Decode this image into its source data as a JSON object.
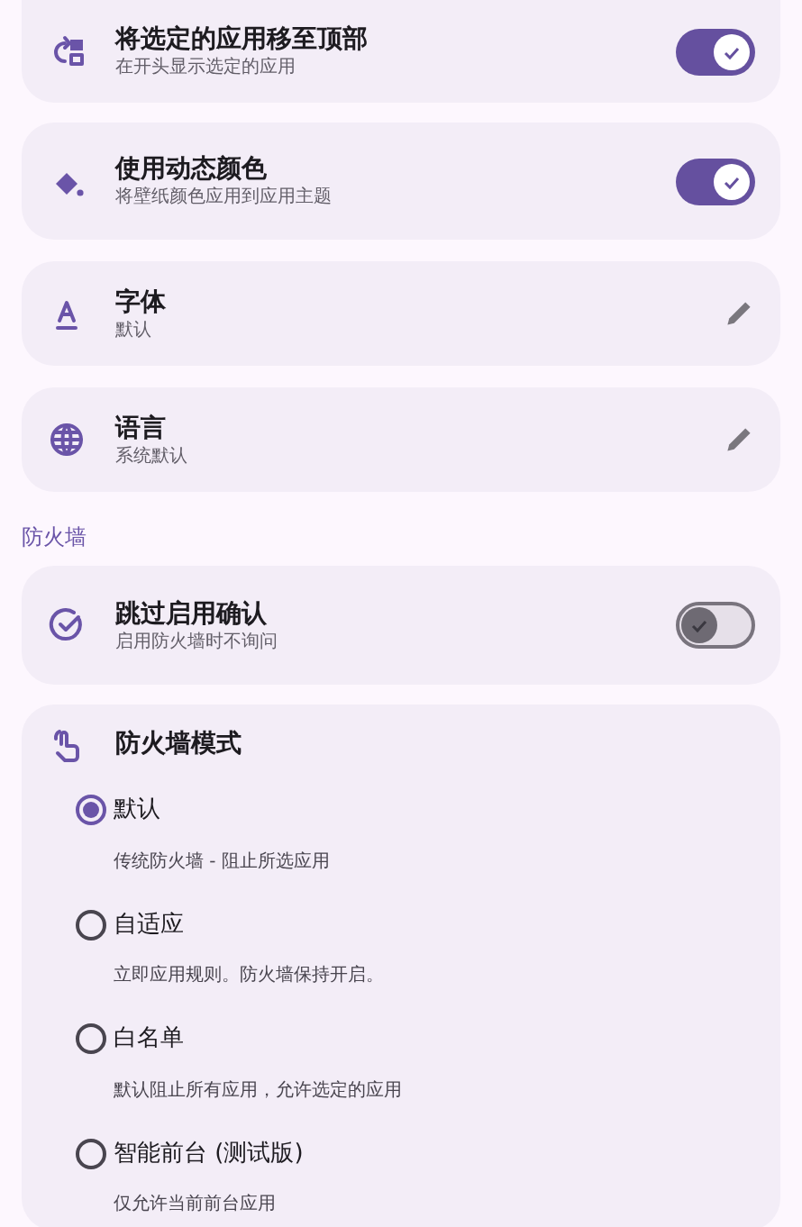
{
  "settings": [
    {
      "kind": "toggle",
      "title": "将选定的应用移至顶部",
      "subtitle": "在开头显示选定的应用",
      "on": true
    },
    {
      "kind": "toggle",
      "title": "使用动态颜色",
      "subtitle": "将壁纸颜色应用到应用主题",
      "on": true
    },
    {
      "kind": "edit",
      "title": "字体",
      "subtitle": "默认"
    },
    {
      "kind": "edit",
      "title": "语言",
      "subtitle": "系统默认"
    }
  ],
  "section": {
    "title": "防火墙",
    "items": [
      {
        "kind": "toggle",
        "title": "跳过启用确认",
        "subtitle": "启用防火墙时不询问",
        "on": false
      }
    ],
    "mode": {
      "title": "防火墙模式",
      "options": [
        {
          "label": "默认",
          "description": "传统防火墙 - 阻止所选应用",
          "selected": true
        },
        {
          "label": "自适应",
          "description": "立即应用规则。防火墙保持开启。",
          "selected": false
        },
        {
          "label": "白名单",
          "description": "默认阻止所有应用，允许选定的应用",
          "selected": false
        },
        {
          "label": "智能前台 (测试版)",
          "description": "仅允许当前前台应用",
          "selected": false
        }
      ]
    }
  }
}
